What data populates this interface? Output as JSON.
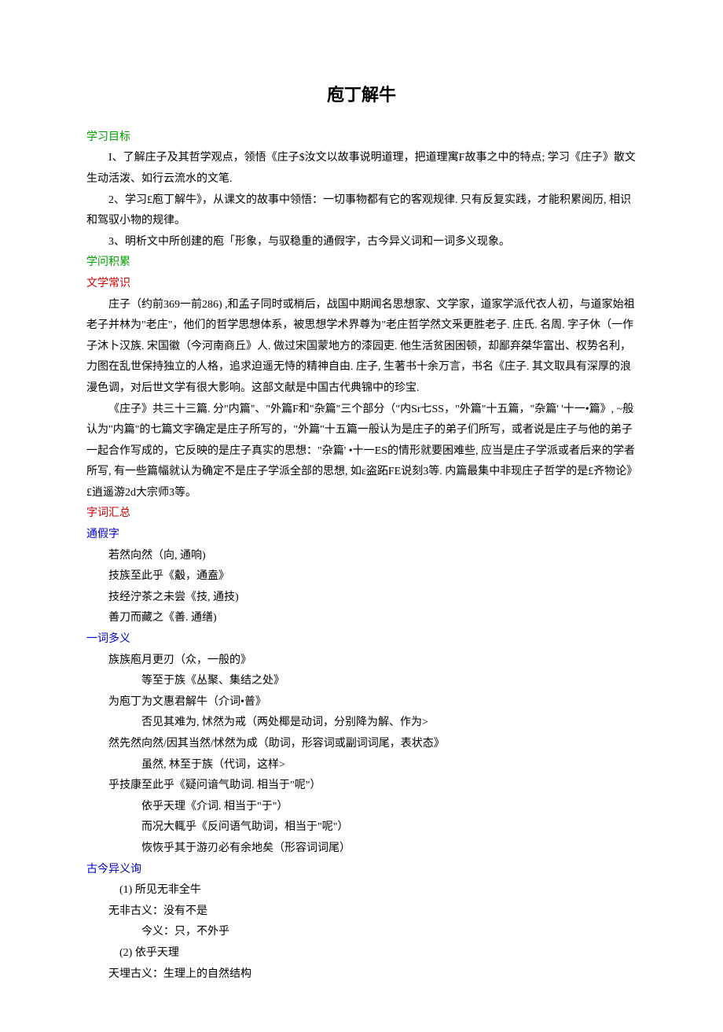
{
  "title": "庖丁解牛",
  "sec1_heading": "学习目标",
  "goals": {
    "g1": "I、了解庄子及其哲学观点，领悟《庄子$汝文以故事说明道理，把道理寓F故事之中的特点; 学习《庄子》散文生动活泼、如行云流水的文笔.",
    "g2": "2、学习£庖丁解牛》，从课文的故事中领悟：一切事物都有它的客观规律. 只有反复实践，才能积累阅历, 相识和驾驭小物的规律。",
    "g3": "3、明析文中所创建的庖「形象，与驭稳重的通假字，古今异义词和一词多义现象。"
  },
  "sec2_heading": "学问积累",
  "sec2_sub1": "文学常识",
  "literature": {
    "p1": "庄子（约前369一前286) ,和孟子同时或梢后，战国中期闻名思想家、文学家，道家学派代衣人初，与道家始祖老子并林为\"老庄\"，他们的哲学思想体系，被思想学术界尊为\"老庄哲学然文釆更胜老子. 庄氏. 名周. 字子休（一作子沐卜汉族. 宋国徽（今河南商丘》人. 做过宋国蒙地方的漆园吏. 他生活贫困困顿，却鄙弃桀华富出、权势名利，力图在乱世保持独立的人格，追求迫遥无恃的精神自由. 庄子, 生著书十余万言，书名《庄子.  其文取具有深厚的浪漫色调，对后世文学有很大影响。这部文献是中国古代典锦中的珍宝.",
    "p2": "《庄子》共三十三篇. 分\"内篇\"、\"外篇F和\"杂篇\"三个部分（\"内Sr七SS，\"外篇\"十五篇，\"杂篇' '十一•篇》, ~般认为\"内篇\"的七篇文字确定是庄子所写的，\"外篇\"十五篇一般认为是庄子的弟子们所写，或者说是庄子与他的弟子一起合作写成的，它反映的是庄子真实的思想：\"杂篇' •十一ES的情形就要困难些, 应当是庄子学派或者后来的学者所写, 有一些篇幅就认为确定不是庄子学派全部的思想, 如ε盗跖FE说刻3等. 内篇最集中非现庄子哲学的是£齐物论》£逍遥游2d大宗师3等。"
  },
  "sec2_sub2": "字词汇总",
  "sec_tongjia": "通假字",
  "tongjia": {
    "t1": "若然向然（向, 通响)",
    "t2": "技族至此乎《觳，通盍》",
    "t3": "技经泞茶之未尝《技, 通技)",
    "t4": "善刀而藏之《善. 通缮)"
  },
  "sec_yici": "一词多义",
  "yici": {
    "y1": "族族庖月更刃（众，一般的》",
    "y1b": "等至于族《丛聚、集结之处》",
    "y2": "为庖丁为文惠君解牛（介词•普》",
    "y2b": "否见其难为, 怵然为戒（两处椰是动词，分别降为解、作为>",
    "y3": "然先然向然/因其当然/怵然为成（助词，形容词或副词词尾，表状态》",
    "y3b": "虽然, 林至于族（代词，这样>",
    "y4": "乎技康至此乎《疑问谙气助词. 相当于\"呢\"）",
    "y4b": "依乎天理《介词. 相当于\"于\"）",
    "y4c": "而况大輒乎《反问语气助词，相当于\"呢\"）",
    "y4d": "恢恢乎其于游刃必有余地矣（形容词词尾）"
  },
  "sec_gujin": "古今异义询",
  "gujin": {
    "g1_num": "(1) 所见无非全牛",
    "g1_a": "无非古义：没有不是",
    "g1_b": "今义：只，不外乎",
    "g2_num": "(2) 依乎天理",
    "g2_a": "天埋古义：生理上的自然结构"
  }
}
